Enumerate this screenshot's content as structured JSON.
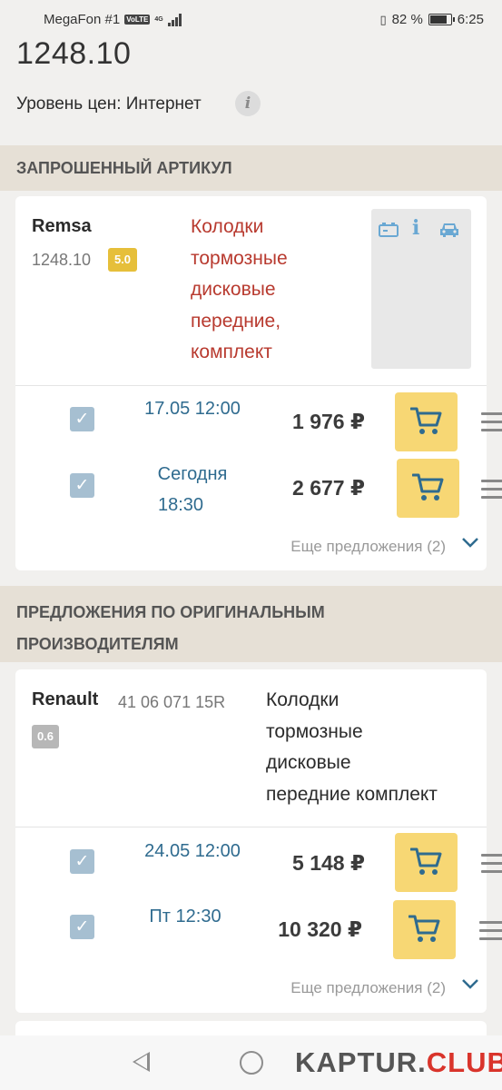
{
  "status_bar": {
    "carrier": "MegaFon #1",
    "volte": "VoLTE",
    "network": "4G",
    "battery": "82 %",
    "time": "6:25"
  },
  "header": {
    "article_number": "1248.10",
    "price_level": "Уровень цен: Интернет",
    "info_icon_glyph": "i"
  },
  "sections": {
    "requested": "ЗАПРОШЕННЫЙ АРТИКУЛ",
    "original": "ПРЕДЛОЖЕНИЯ ПО ОРИГИНАЛЬНЫМ ПРОИЗВОДИТЕЛЯМ"
  },
  "product1": {
    "brand": "Remsa",
    "article": "1248.10",
    "rating": "5.0",
    "description_lines": [
      "Колодки",
      "тормозные",
      "дисковые",
      "передние,",
      "комплект"
    ],
    "offers": [
      {
        "date": "17.05 12:00",
        "price": "1 976 ₽"
      },
      {
        "date_line1": "Сегодня",
        "date_line2": "18:30",
        "price": "2 677 ₽"
      }
    ],
    "more": "Еще предложения (2)"
  },
  "product2": {
    "brand": "Renault",
    "article": "41 06 071 15R",
    "rating": "0.6",
    "description_lines": [
      "Колодки",
      "тормозные",
      "дисковые",
      "передние комплект"
    ],
    "offers": [
      {
        "date": "24.05 12:00",
        "price": "5 148 ₽"
      },
      {
        "date": "Пт 12:30",
        "price": "10 320 ₽"
      }
    ],
    "more": "Еще предложения (2)"
  },
  "icons": {
    "check": "✓",
    "chevron": "✔",
    "info": "i",
    "battery_icon": "battery-icon",
    "car_icon": "car-icon"
  },
  "colors": {
    "accent_red": "#b83a2f",
    "link_blue": "#2f6b8f",
    "cart_yellow": "#f7d774",
    "rating_gold": "#e6bf3a"
  },
  "watermark": {
    "part1": "KAPTUR.",
    "part2": "CLUB"
  }
}
